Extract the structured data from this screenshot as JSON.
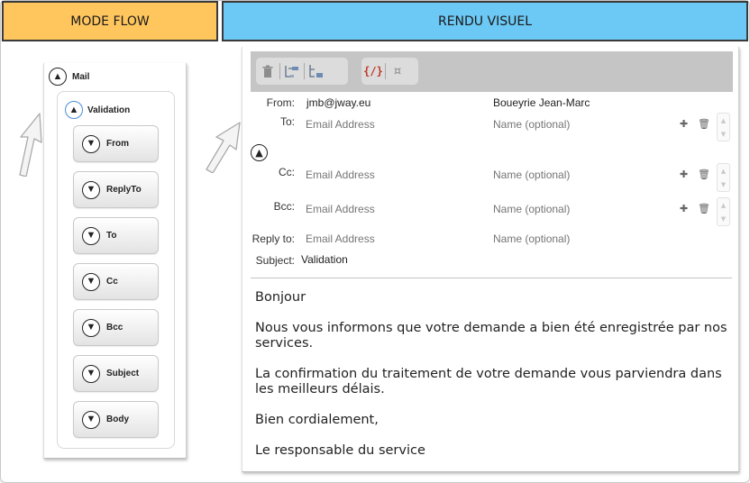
{
  "headers": {
    "left": "MODE FLOW",
    "right": "RENDU VISUEL"
  },
  "flow": {
    "root": {
      "label": "Mail",
      "icon": "chevron-up-icon"
    },
    "group": {
      "label": "Validation",
      "icon": "chevron-up-icon"
    },
    "nodes": [
      {
        "label": "From",
        "icon": "chevron-down-icon"
      },
      {
        "label": "ReplyTo",
        "icon": "chevron-down-icon"
      },
      {
        "label": "To",
        "icon": "chevron-down-icon"
      },
      {
        "label": "Cc",
        "icon": "chevron-down-icon"
      },
      {
        "label": "Bcc",
        "icon": "chevron-down-icon"
      },
      {
        "label": "Subject",
        "icon": "chevron-down-icon"
      },
      {
        "label": "Body",
        "icon": "chevron-down-icon"
      }
    ]
  },
  "toolbar": {
    "items": [
      "trash-icon",
      "insert-before-icon",
      "insert-after-icon",
      "variable-icon",
      "currency-icon"
    ],
    "variable_glyph": "{/}",
    "currency_glyph": "¤"
  },
  "mail": {
    "from": {
      "label": "From:",
      "email": "jmb@jway.eu",
      "name": "Boueyrie Jean-Marc"
    },
    "to": {
      "label": "To:",
      "email_placeholder": "Email Address",
      "name_placeholder": "Name (optional)"
    },
    "cc": {
      "label": "Cc:",
      "email_placeholder": "Email Address",
      "name_placeholder": "Name (optional)"
    },
    "bcc": {
      "label": "Bcc:",
      "email_placeholder": "Email Address",
      "name_placeholder": "Name (optional)"
    },
    "reply_to": {
      "label": "Reply to:",
      "email_placeholder": "Email Address",
      "name_placeholder": "Name (optional)"
    },
    "subject": {
      "label": "Subject:",
      "value": "Validation"
    },
    "body": [
      "Bonjour",
      "Nous vous informons que votre demande a bien été enregistrée par nos services.",
      "La confirmation du traitement de votre demande vous parviendra dans les meilleurs délais.",
      "Bien cordialement,",
      "Le responsable du service"
    ]
  },
  "colors": {
    "left_header": "#ffc65e",
    "right_header": "#6cc8f4",
    "accent_blue": "#4a8fd6"
  }
}
